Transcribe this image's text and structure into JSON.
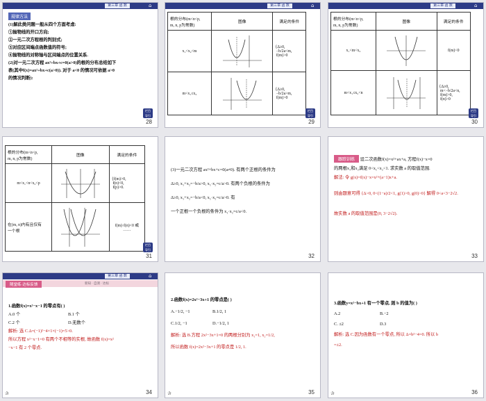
{
  "common": {
    "header_chip": "第三章 函 数",
    "back_label_1": "栏目",
    "back_label_2": "导引",
    "star": "✰"
  },
  "slides": {
    "s28": {
      "number": "28",
      "tag": "规律方法",
      "lines": [
        "(1)解此类问题一般从四个方面考虑:",
        "①抛物线的开口方向;",
        "②一元二次方程根的判别式;",
        "③对应区间端点函数值的符号;",
        "④抛物线的对称轴与区间端点的位置关系.",
        "(2)对一元二次方程 ax²+bx+c=0(a>0)的根的分布总结如下",
        "表(其中f(x)=ax²+bx+c(a>0)). 对于 a<0 的情况可依据 a>0",
        "的情况判断):"
      ]
    },
    "s29": {
      "number": "29",
      "h1": "根的分布(m<n<p,",
      "h1b": "m, n, p为常数)",
      "h2": "图像",
      "h3": "满足的条件",
      "r1": "x₁<x₂<m",
      "r1c": [
        "Δ≥0,",
        "−b/2a<m,",
        "f(m)>0"
      ],
      "r2": "m<x₁≤x₂",
      "r2c": [
        "Δ≥0,",
        "−b/2a>m,",
        "f(m)>0"
      ]
    },
    "s30": {
      "number": "30",
      "h1": "根的分布(m<n<p,",
      "h1b": "m, n, p为常数)",
      "h2": "图像",
      "h3": "满足的条件",
      "r1": "x₁<m<x₂",
      "r1c": "f(m)<0",
      "r2": "m<x₁≤x₂<n",
      "r2c": [
        "Δ≥0,",
        "m<−b/2a<n,",
        "f(m)>0,",
        "f(n)>0"
      ]
    },
    "s31": {
      "number": "31",
      "h1": "根的分布(m<n<p,",
      "h1b": "m, n, p为常数)",
      "h2": "图像",
      "h3": "满足的条件",
      "r1": "m<x₁<n<x₂<p",
      "r1c": [
        "f(m)>0,",
        "f(n)<0,",
        "f(p)>0."
      ],
      "r2a": "在(m, n)内有且仅有",
      "r2b": "一个根",
      "r2c": [
        "f(m)·f(n)<0 或",
        "……"
      ]
    },
    "s32": {
      "number": "32",
      "lines": [
        "(3)一元二次方程 ax²+bx+c=0(a≠0). 有两个正根的条件为",
        "Δ≥0,  x₁+x₂=−b/a>0,  x₁·x₂=c/a>0. 有两个负根的条件为",
        "Δ≥0,  x₁+x₂=−b/a<0,  x₁·x₂=c/a>0. 有",
        "一个正根一个负根的条件为 x₁·x₂=c/a<0."
      ]
    },
    "s33": {
      "number": "33",
      "tag": "跟踪训练",
      "q1": "设二次函数f(x)=x²+ax+a, 方程f(x)−x=0",
      "q2": "的两根x₁和x₂满足 0<x₁<x₂<1. 求实数 a 的取值范围.",
      "s1": "解法: 令 g(x)=f(x)−x=x²+(a−1)x+a.",
      "s2": "则由题意可得 {Δ>0, 0<(1−a)/2<1, g(1)>0, g(0)>0} 解得 0<a<3−2√2.",
      "s3": "故实数 a 的取值范围是(0, 3−2√2)."
    },
    "s34": {
      "number": "34",
      "bar": "随堂练·达标反馈",
      "tools": "新知 · 自测 · 达标",
      "q": "1.函数f(x)=x²−x−1 的零点有(      )",
      "a": "A.0 个",
      "b": "B.1 个",
      "c": "C.2 个",
      "d": "D.无数个",
      "s1": "解析: 选 C.Δ=(−1)²−4×1×(−1)=5>0.",
      "s2": "所以方程 x²−x−1=0 有两个不相等的实根, 故函数 f(x)=x²",
      "s3": "−x−1 有 2 个零点."
    },
    "s35": {
      "number": "35",
      "q": "2.函数f(x)=2x²−3x+1 的零点是(      )",
      "a": "A.−1/2, −1",
      "b": "B.1/2, 1",
      "c": "C.1/2, −1",
      "d": "D.−1/2, 1",
      "s1": "解析: 选 B.方程 2x²−3x+1=0 的两根分别为 x₁=1, x₂=1/2,",
      "s2": "所以函数 f(x)=2x²−3x+1 的零点是 1/2, 1."
    },
    "s36": {
      "number": "36",
      "q": "3.函数y=x²−bx+1 有一个零点, 则 b 的值为(      )",
      "a": "A.2",
      "b": "B.−2",
      "c": "C. ±2",
      "d": "D.3",
      "s1": "解析: 选 C.因为函数有一个零点, 所以 Δ=b²−4=0. 所以 b",
      "s2": "=±2."
    }
  }
}
